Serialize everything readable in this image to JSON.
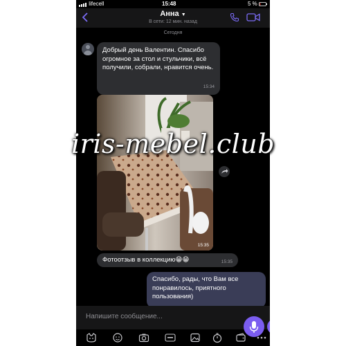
{
  "status_bar": {
    "carrier": "lifecell",
    "time": "15:48",
    "battery": "5 %"
  },
  "header": {
    "contact_name": "Анна",
    "last_seen": "В сети: 12 мин. назад"
  },
  "date_separator": "Сегодня",
  "messages": [
    {
      "direction": "incoming",
      "text": "Добрый день Валентин. Спасибо огромное за стол и стульчики, всё получили, собрали, нравится очень.",
      "time": "15:34"
    },
    {
      "direction": "incoming",
      "type": "photo",
      "time": "15:35"
    },
    {
      "direction": "incoming",
      "text": "Фотоотзыв в коллекцию😁😁",
      "time": "15:35"
    },
    {
      "direction": "outgoing",
      "text": "Спасибо, рады, что Вам все понравилось, приятного пользования)"
    }
  ],
  "watermark": "iris-mebel.club",
  "composer": {
    "placeholder": "Напишите сообщение..."
  },
  "colors": {
    "accent": "#7b5df0",
    "incoming_bubble": "#2d2e31",
    "outgoing_bubble": "#3a3d57"
  },
  "icons": [
    "back-icon",
    "phone-icon",
    "video-icon",
    "mic-icon",
    "sticker-icon",
    "emoji-icon",
    "camera-icon",
    "gif-icon",
    "gallery-icon",
    "timer-icon",
    "wallet-icon",
    "more-icon",
    "share-icon"
  ]
}
